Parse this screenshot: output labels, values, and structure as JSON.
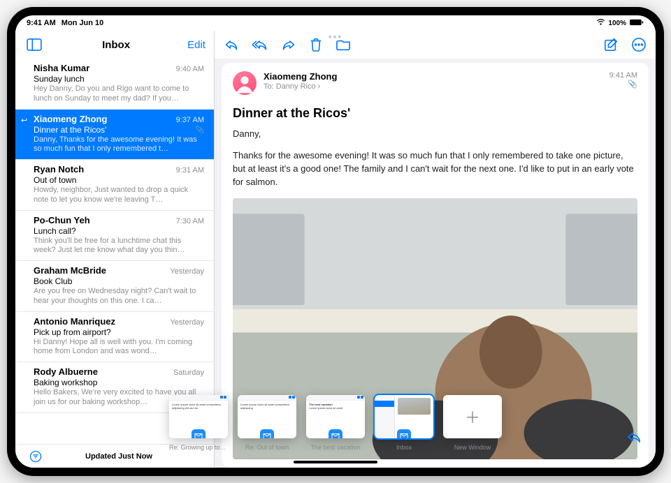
{
  "status": {
    "time": "9:41 AM",
    "date": "Mon Jun 10",
    "battery": "100%"
  },
  "sidebar": {
    "title": "Inbox",
    "edit": "Edit",
    "footer_status": "Updated Just Now",
    "messages": [
      {
        "sender": "Nisha Kumar",
        "time": "9:40 AM",
        "subject": "Sunday lunch",
        "preview": "Hey Danny, Do you and Rigo want to come to lunch on Sunday to meet my dad? If you…",
        "selected": false,
        "replied": false,
        "attachment": false
      },
      {
        "sender": "Xiaomeng Zhong",
        "time": "9:37 AM",
        "subject": "Dinner at the Ricos'",
        "preview": "Danny, Thanks for the awesome evening! It was so much fun that I only remembered t…",
        "selected": true,
        "replied": true,
        "attachment": true
      },
      {
        "sender": "Ryan Notch",
        "time": "9:31 AM",
        "subject": "Out of town",
        "preview": "Howdy, neighbor, Just wanted to drop a quick note to let you know we're leaving T…",
        "selected": false,
        "replied": false,
        "attachment": false
      },
      {
        "sender": "Po-Chun Yeh",
        "time": "7:30 AM",
        "subject": "Lunch call?",
        "preview": "Think you'll be free for a lunchtime chat this week? Just let me know what day you thin…",
        "selected": false,
        "replied": false,
        "attachment": false
      },
      {
        "sender": "Graham McBride",
        "time": "Yesterday",
        "subject": "Book Club",
        "preview": "Are you free on Wednesday night? Can't wait to hear your thoughts on this one. I ca…",
        "selected": false,
        "replied": false,
        "attachment": false
      },
      {
        "sender": "Antonio Manriquez",
        "time": "Yesterday",
        "subject": "Pick up from airport?",
        "preview": "Hi Danny! Hope all is well with you. I'm coming home from London and was wond…",
        "selected": false,
        "replied": false,
        "attachment": false
      },
      {
        "sender": "Rody Albuerne",
        "time": "Saturday",
        "subject": "Baking workshop",
        "preview": "Hello Bakers, We're very excited to have you all join us for our baking workshop…",
        "selected": false,
        "replied": false,
        "attachment": false
      }
    ]
  },
  "detail": {
    "from": "Xiaomeng Zhong",
    "to_label": "To:",
    "to_name": "Danny Rico",
    "time": "9:41 AM",
    "subject": "Dinner at the Ricos'",
    "greeting": "Danny,",
    "body": "Thanks for the awesome evening! It was so much fun that I only remembered to take one picture, but at least it's a good one! The family and I can't wait for the next one. I'd like to put in an early vote for salmon."
  },
  "shelf": [
    {
      "label": "Re: Growing up too fast!"
    },
    {
      "label": "Re: Out of town"
    },
    {
      "label": "The best vacation"
    },
    {
      "label": "Inbox"
    },
    {
      "label": "New Window"
    }
  ]
}
